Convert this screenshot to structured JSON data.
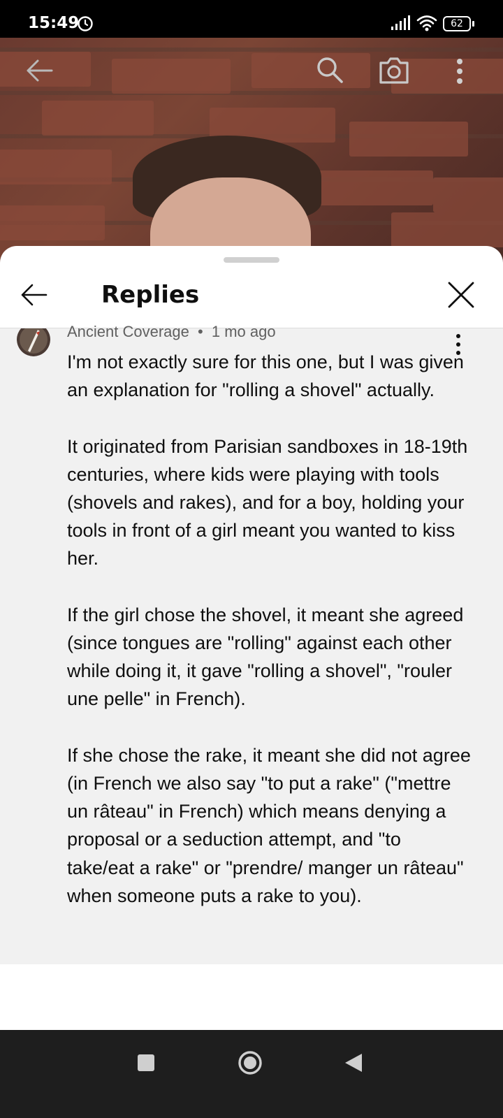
{
  "status_bar": {
    "time": "15:49",
    "battery": "62",
    "icons": [
      "alarm-icon",
      "signal-icon",
      "wifi-icon",
      "battery-icon"
    ]
  },
  "video_toolbar": {
    "icons": [
      "back-arrow-icon",
      "search-icon",
      "camera-icon",
      "more-vertical-icon"
    ]
  },
  "sheet": {
    "title": "Replies",
    "icons": [
      "back-arrow-icon",
      "close-icon"
    ]
  },
  "comment": {
    "author": "Ancient Coverage",
    "separator": "•",
    "time": "1 mo ago",
    "text": "I'm not exactly sure for this one, but I was given an explanation for \"rolling a shovel\" actually.\n\nIt originated from Parisian sandboxes in 18-19th centuries, where kids were playing with tools (shovels and rakes), and for a boy, holding your tools in front of a girl meant you wanted to kiss her.\n\nIf the girl chose the shovel, it meant she agreed (since tongues are \"rolling\" against each other while doing it, it gave \"rolling a shovel\", \"rouler une pelle\" in French).\n\nIf she chose the rake, it meant she did not agree (in French we also say \"to put a rake\" (\"mettre un râteau\" in French) which means denying a proposal or a seduction attempt, and \"to take/eat a rake\" or \"prendre/ manger un râteau\" when someone puts a rake to you)."
  },
  "nav_bar": {
    "icons": [
      "recent-apps-icon",
      "home-icon",
      "back-icon"
    ]
  }
}
